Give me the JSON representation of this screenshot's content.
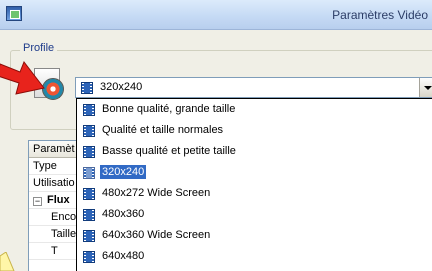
{
  "window": {
    "title": "Paramètres Vidéo"
  },
  "profile": {
    "group_label": "Profile",
    "selected_value": "320x240"
  },
  "properties": {
    "header": "Paramèt",
    "rows": [
      {
        "label": "Type",
        "kind": "plain"
      },
      {
        "label": "Utilisatio",
        "kind": "plain"
      },
      {
        "label": "Flux",
        "kind": "group",
        "expander": "−"
      },
      {
        "label": "Enco",
        "kind": "child"
      },
      {
        "label": "Taille",
        "kind": "child"
      },
      {
        "label": "T",
        "kind": "child"
      }
    ]
  },
  "dropdown": {
    "items": [
      {
        "label": "Bonne qualité, grande taille",
        "selected": false
      },
      {
        "label": "Qualité et taille normales",
        "selected": false
      },
      {
        "label": "Basse qualité et petite taille",
        "selected": false
      },
      {
        "label": "320x240",
        "selected": true
      },
      {
        "label": "480x272 Wide Screen",
        "selected": false
      },
      {
        "label": "480x360",
        "selected": false
      },
      {
        "label": "640x360 Wide Screen",
        "selected": false
      },
      {
        "label": "640x480",
        "selected": false
      }
    ]
  },
  "colors": {
    "selection": "#316ac5",
    "arrow": "#e8231c",
    "titlebar": "#c4d9f4",
    "group_label": "#1e3b8a"
  },
  "icons": {
    "app": "app-icon",
    "profile": "media-profile-icon",
    "list_item": "film-icon",
    "combo_button": "chevron-down-icon"
  }
}
